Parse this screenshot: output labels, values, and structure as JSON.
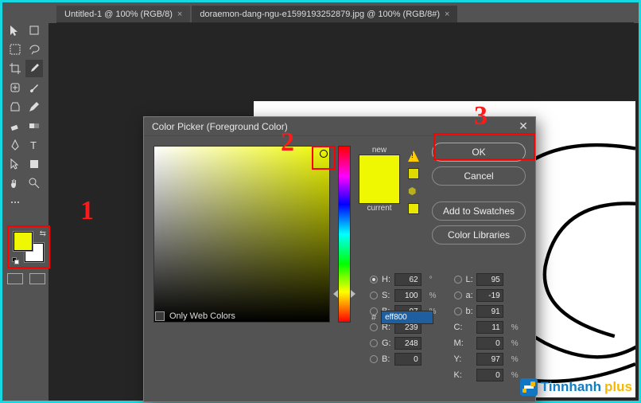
{
  "tabs": [
    {
      "label": "Untitled-1 @ 100% (RGB/8)"
    },
    {
      "label": "doraemon-dang-ngu-e1599193252879.jpg @ 100% (RGB/8#)"
    }
  ],
  "dialog": {
    "title": "Color Picker (Foreground Color)",
    "new_label": "new",
    "current_label": "current",
    "ok": "OK",
    "cancel": "Cancel",
    "add_swatch": "Add to Swatches",
    "color_libs": "Color Libraries",
    "only_web": "Only Web Colors",
    "fields": {
      "H": "62",
      "H_unit": "°",
      "S": "100",
      "S_unit": "%",
      "B": "97",
      "B_unit": "%",
      "R": "239",
      "G": "248",
      "Bc": "0",
      "L": "95",
      "a": "-19",
      "b2": "91",
      "C": "11",
      "C_unit": "%",
      "M": "0",
      "M_unit": "%",
      "Y": "97",
      "Y_unit": "%",
      "K": "0",
      "K_unit": "%"
    },
    "hex": "eff800"
  },
  "annotations": {
    "a1": "1",
    "a2": "2",
    "a3": "3"
  },
  "logo": {
    "part1": "Tinnhanh",
    "part2": "plus"
  },
  "tools": [
    "move",
    "artboard",
    "marquee",
    "lasso",
    "crop",
    "eyedropper",
    "patch",
    "brush",
    "clone",
    "pencil",
    "eraser",
    "gradient",
    "pen",
    "text",
    "path",
    "rect",
    "hand",
    "zoom",
    "more1",
    "more2"
  ]
}
